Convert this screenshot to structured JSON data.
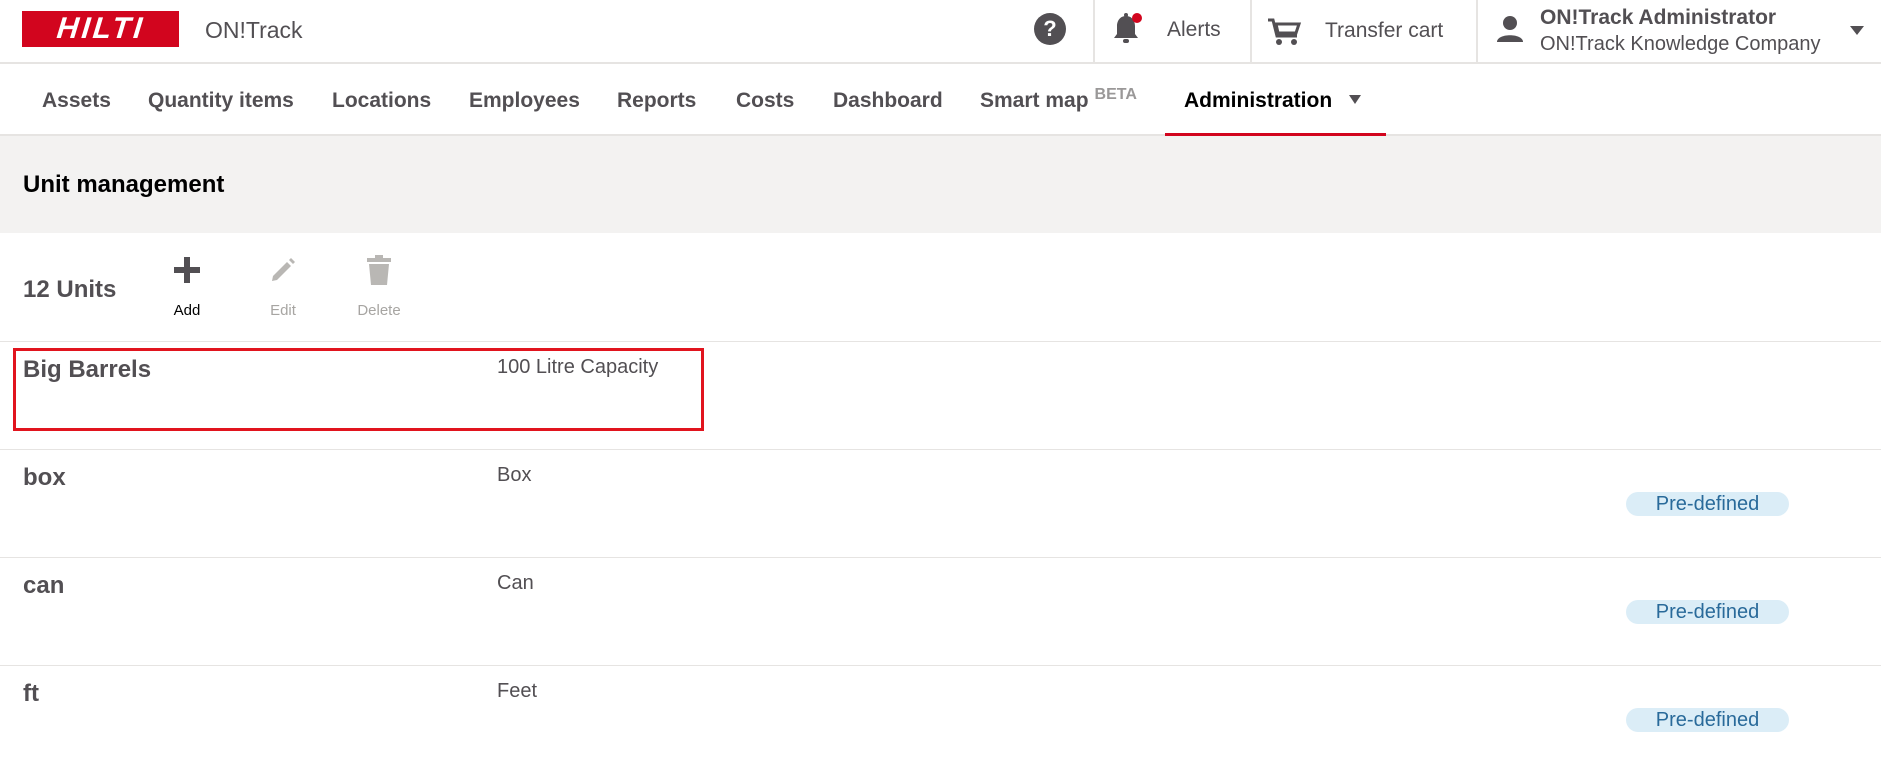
{
  "header": {
    "logo_text": "HILTI",
    "app_name": "ON!Track",
    "help_icon": "question-circle-icon",
    "alerts_label": "Alerts",
    "transfer_cart_label": "Transfer cart",
    "user_name": "ON!Track Administrator",
    "user_company": "ON!Track Knowledge Company"
  },
  "nav": {
    "items": [
      {
        "label": "Assets"
      },
      {
        "label": "Quantity items"
      },
      {
        "label": "Locations"
      },
      {
        "label": "Employees"
      },
      {
        "label": "Reports"
      },
      {
        "label": "Costs"
      },
      {
        "label": "Dashboard"
      },
      {
        "label": "Smart map",
        "badge": "BETA"
      },
      {
        "label": "Administration",
        "active": true
      }
    ]
  },
  "page": {
    "title": "Unit management",
    "count_label": "12 Units"
  },
  "toolbar": {
    "add_label": "Add",
    "edit_label": "Edit",
    "delete_label": "Delete"
  },
  "units": [
    {
      "name": "Big Barrels",
      "description": "100 Litre Capacity",
      "badge": ""
    },
    {
      "name": "box",
      "description": "Box",
      "badge": "Pre-defined"
    },
    {
      "name": "can",
      "description": "Can",
      "badge": "Pre-defined"
    },
    {
      "name": "ft",
      "description": "Feet",
      "badge": "Pre-defined"
    }
  ],
  "colors": {
    "brand_red": "#d2051e",
    "text_dark": "#524f53",
    "badge_bg": "#dbedf7",
    "badge_text": "#296a9a",
    "highlight": "#e1141e"
  }
}
